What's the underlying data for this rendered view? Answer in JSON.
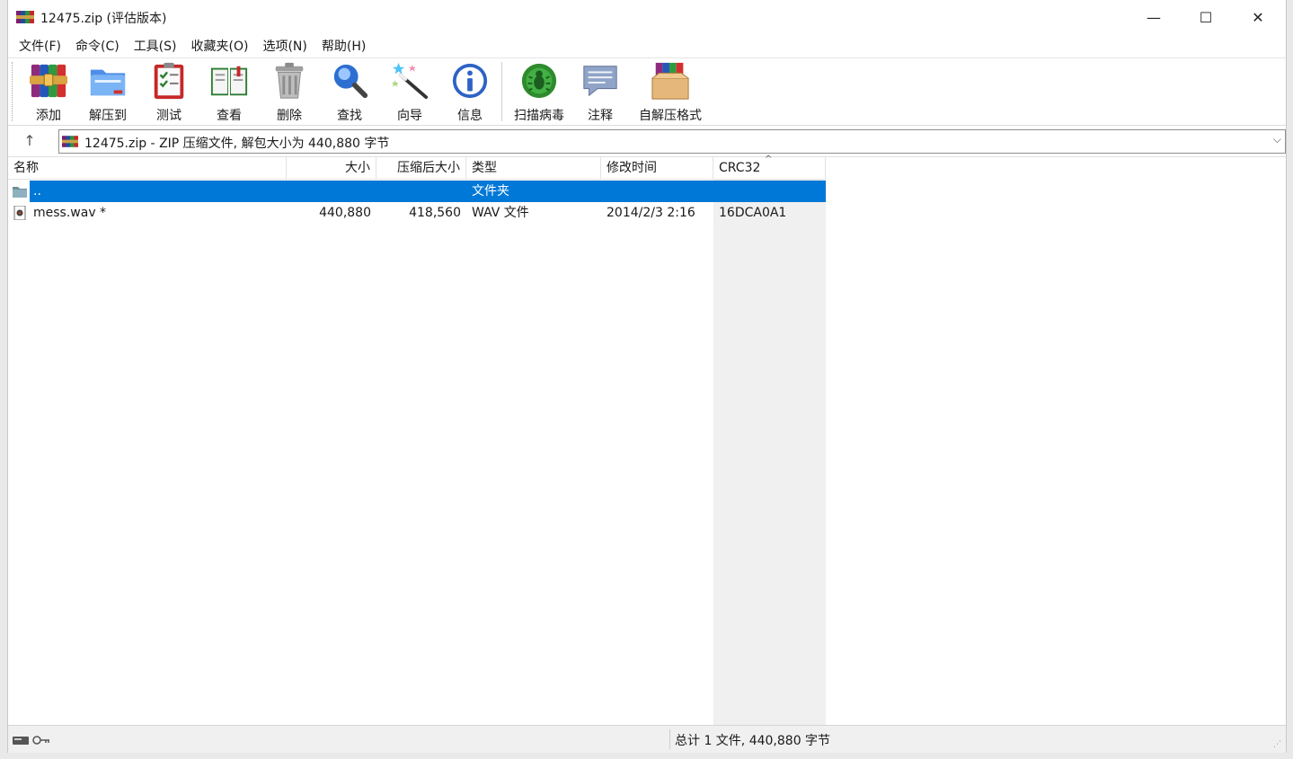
{
  "window": {
    "title": "12475.zip (评估版本)",
    "controls": {
      "minimize": "—",
      "maximize": "☐",
      "close": "✕"
    }
  },
  "menu": [
    "文件(F)",
    "命令(C)",
    "工具(S)",
    "收藏夹(O)",
    "选项(N)",
    "帮助(H)"
  ],
  "toolbar": [
    {
      "label": "添加",
      "icon": "add-archive-icon"
    },
    {
      "label": "解压到",
      "icon": "extract-to-icon"
    },
    {
      "label": "测试",
      "icon": "test-icon"
    },
    {
      "label": "查看",
      "icon": "view-icon"
    },
    {
      "label": "删除",
      "icon": "delete-icon"
    },
    {
      "label": "查找",
      "icon": "find-icon"
    },
    {
      "label": "向导",
      "icon": "wizard-icon"
    },
    {
      "label": "信息",
      "icon": "info-icon"
    },
    {
      "label": "扫描病毒",
      "icon": "virus-scan-icon"
    },
    {
      "label": "注释",
      "icon": "comment-icon"
    },
    {
      "label": "自解压格式",
      "icon": "sfx-icon"
    }
  ],
  "address": {
    "up": "↑",
    "path": "12475.zip - ZIP 压缩文件, 解包大小为 440,880 字节",
    "dropdown": "⌵"
  },
  "columns": {
    "name": "名称",
    "size": "大小",
    "packed": "压缩后大小",
    "type": "类型",
    "modified": "修改时间",
    "crc": "CRC32",
    "sort_indicator": "^"
  },
  "rows": [
    {
      "name": "..",
      "size": "",
      "packed": "",
      "type": "文件夹",
      "modified": "",
      "crc": "",
      "selected": true,
      "icon": "folder-icon"
    },
    {
      "name": "mess.wav *",
      "size": "440,880",
      "packed": "418,560",
      "type": "WAV 文件",
      "modified": "2014/2/3 2:16",
      "crc": "16DCA0A1",
      "selected": false,
      "icon": "audio-file-icon"
    }
  ],
  "status": {
    "summary": "总计 1 文件, 440,880 字节"
  },
  "colors": {
    "selection": "#0078d7",
    "crc_column_shade": "#f0f0f0"
  }
}
